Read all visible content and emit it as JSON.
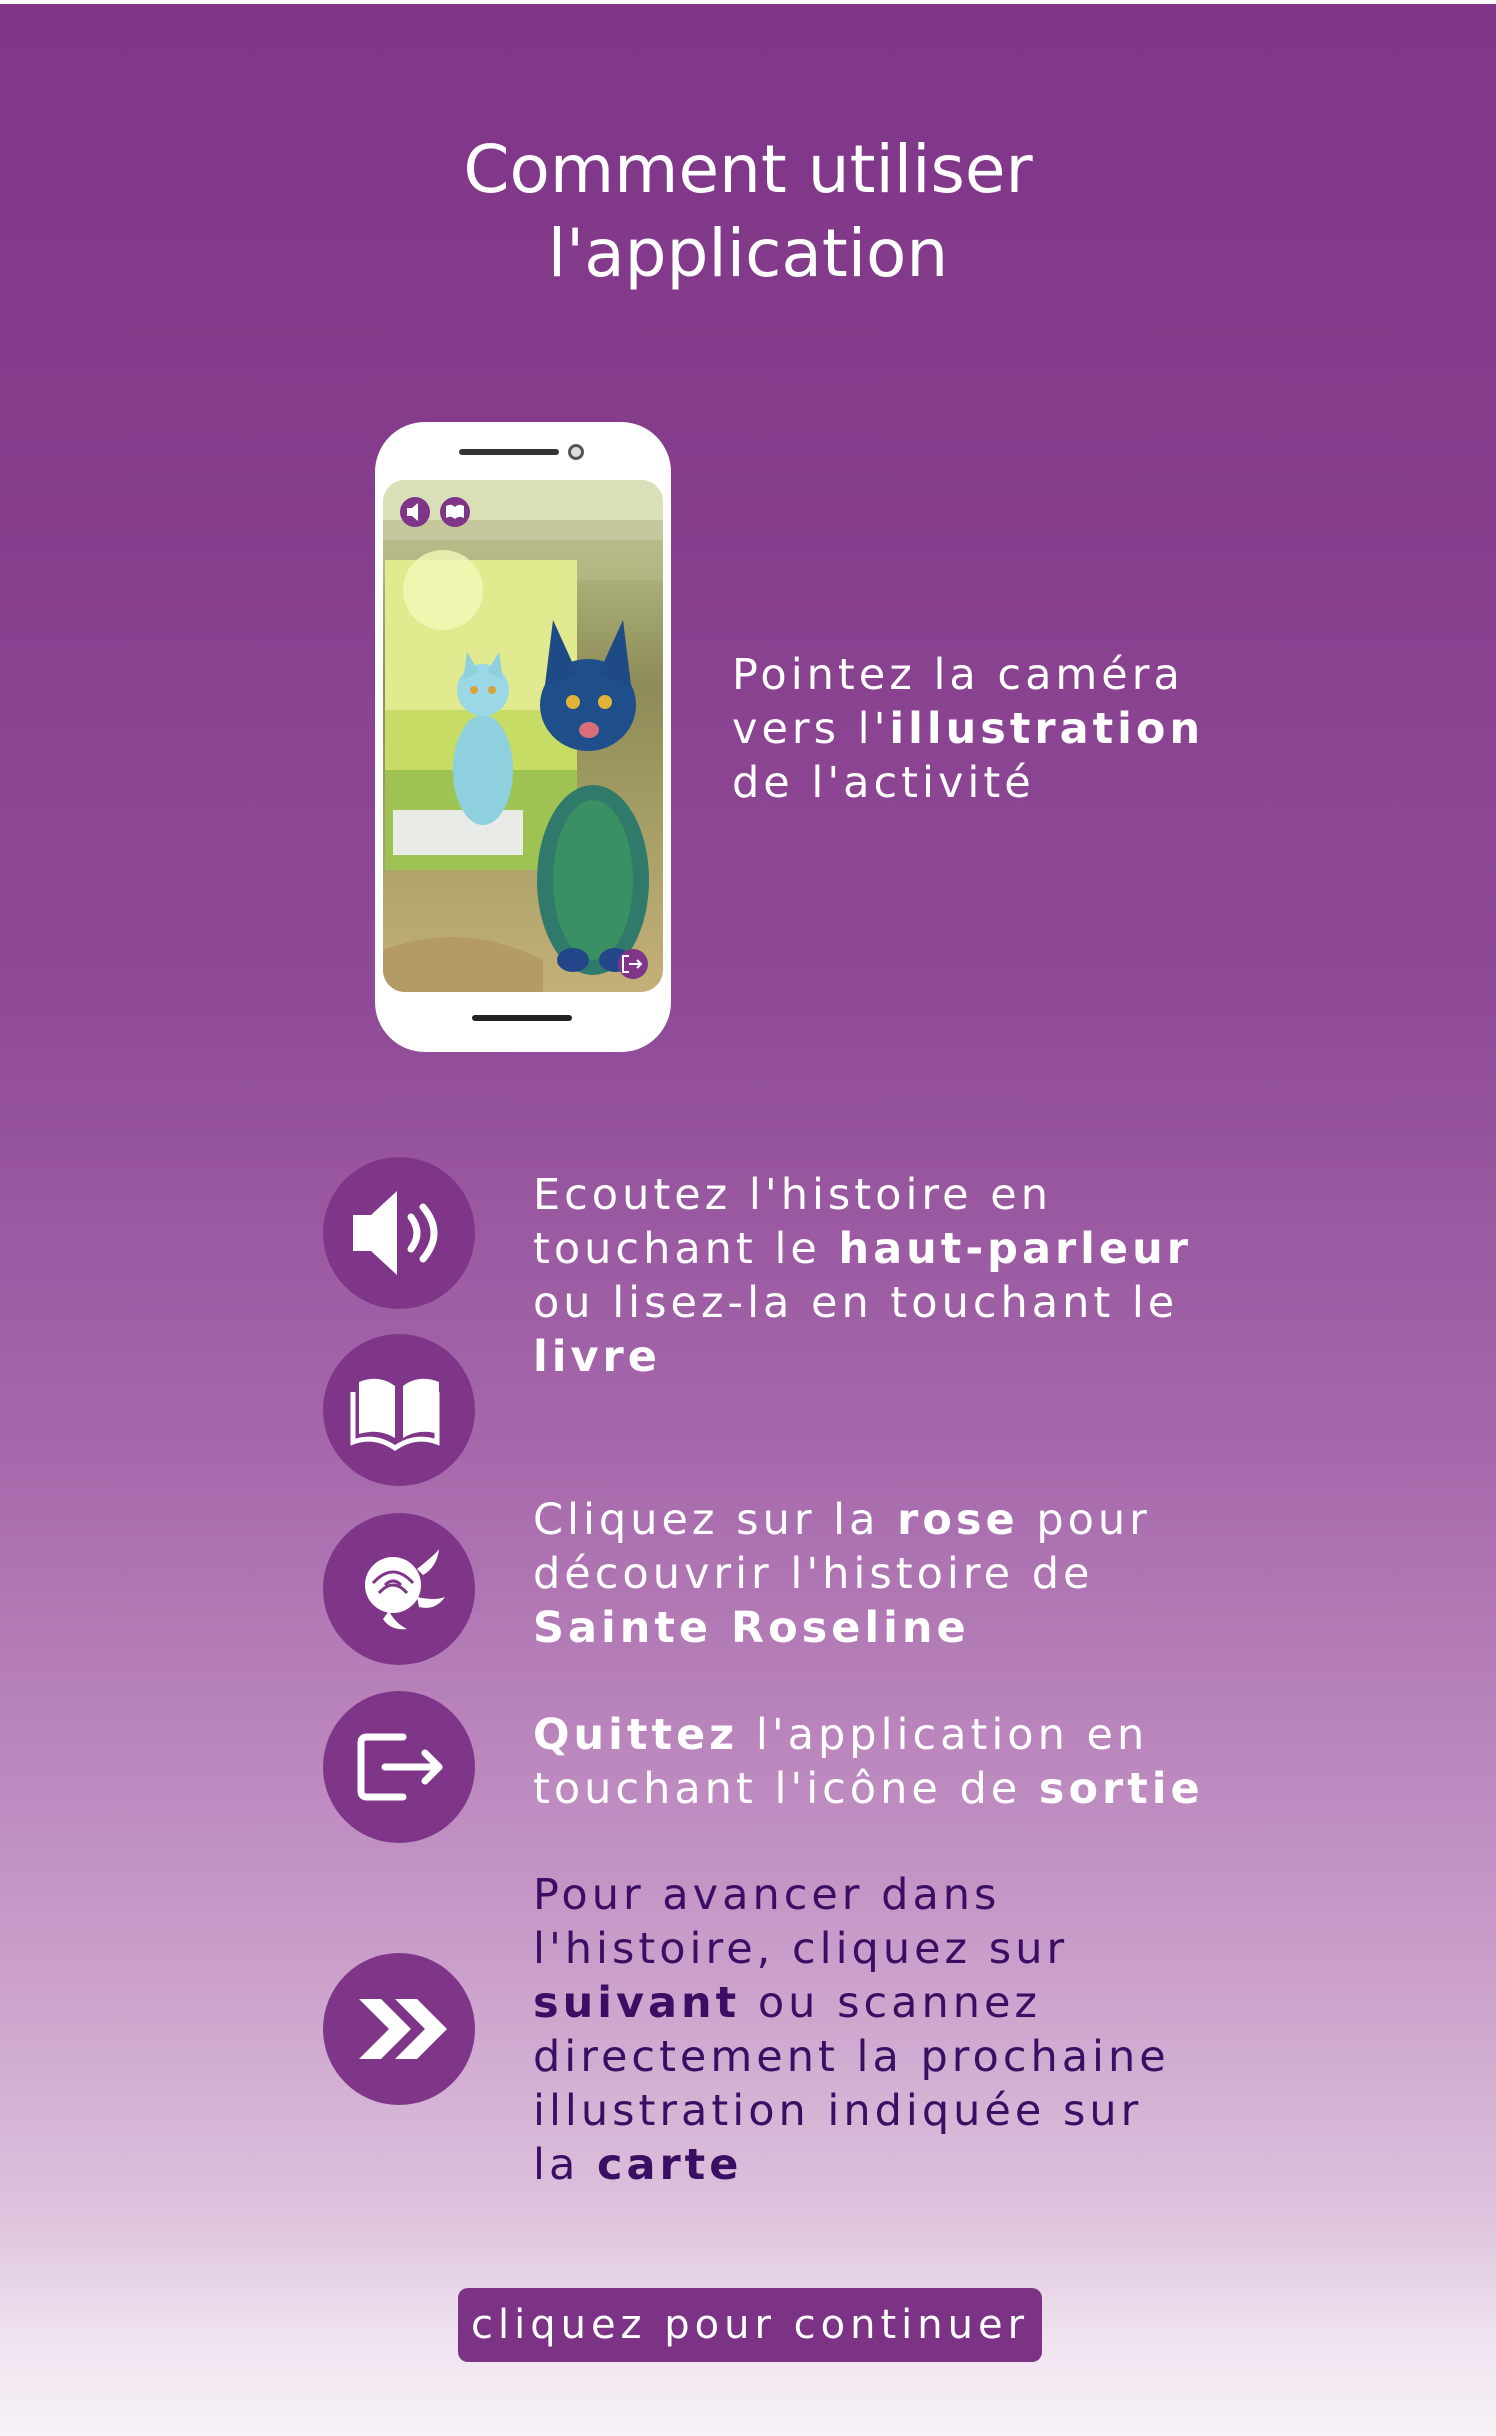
{
  "title": {
    "line1": "Comment utiliser",
    "line2": "l'application"
  },
  "step_camera": {
    "icon": "phone-ar-illustration",
    "line1": "Pointez la caméra",
    "line2_pre": "vers l'",
    "line2_bold": "illustration",
    "line3": "de l'activité"
  },
  "step_listen": {
    "icons": [
      "speaker-icon",
      "book-icon"
    ],
    "line1": "Ecoutez l'histoire en",
    "line2_pre": "touchant le ",
    "line2_bold": "haut-parleur",
    "line3": "ou lisez-la en touchant le",
    "line4_bold": "livre"
  },
  "step_rose": {
    "icon": "rose-icon",
    "line1_pre": "Cliquez sur la ",
    "line1_bold": "rose",
    "line1_post": " pour",
    "line2": "découvrir l'histoire de",
    "line3_bold": "Sainte Roseline"
  },
  "step_exit": {
    "icon": "exit-icon",
    "line1_bold": "Quittez",
    "line1_post": " l'application en",
    "line2_pre": "touchant l'icône de ",
    "line2_bold": "sortie"
  },
  "step_next": {
    "icon": "double-chevron-right-icon",
    "line1": "Pour avancer dans",
    "line2": "l'histoire, cliquez sur",
    "line3_bold": "suivant",
    "line3_post": " ou scannez",
    "line4": "directement  la prochaine",
    "line5": "illustration indiquée sur",
    "line6_pre": "la ",
    "line6_bold": "carte"
  },
  "continue_button": {
    "label": "cliquez pour continuer"
  },
  "colors": {
    "background_top": "#813689",
    "background_bottom": "#f8f2f8",
    "icon_circle": "#7f3688",
    "button": "#7c3386",
    "dark_text": "#3a0f63"
  }
}
